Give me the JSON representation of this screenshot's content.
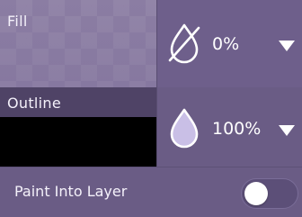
{
  "fill": {
    "label": "Fill",
    "opacity_value": "0%",
    "opacity_icon": "opacity-off-icon",
    "dropdown_icon": "chevron-down-icon"
  },
  "outline": {
    "label": "Outline",
    "opacity_value": "100%",
    "opacity_icon": "opacity-drop-icon",
    "dropdown_icon": "chevron-down-icon",
    "swatch_color": "#000000"
  },
  "paint_into_layer": {
    "label": "Paint Into Layer",
    "toggle_state": "off"
  },
  "colors": {
    "panel_bg": "#6a5c85",
    "drop_fill": "#c9bfe6",
    "text": "#ffffff"
  }
}
